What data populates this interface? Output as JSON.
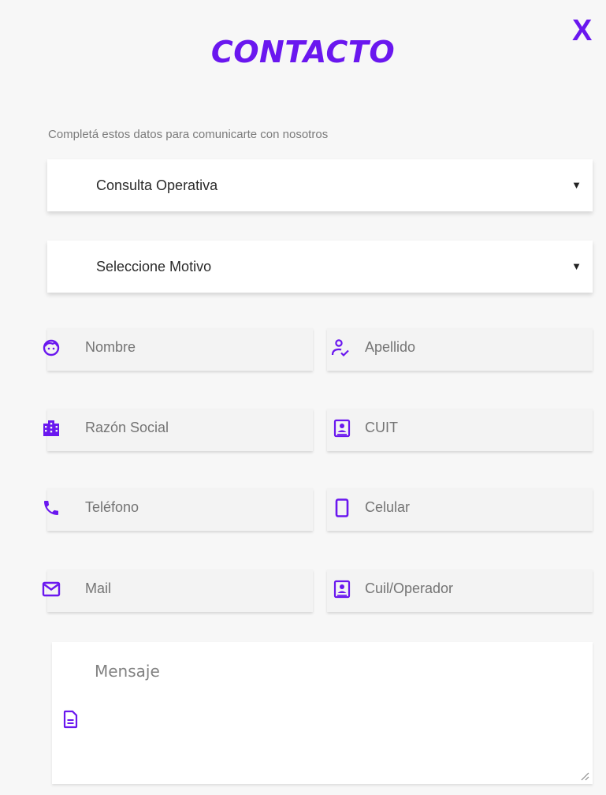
{
  "header": {
    "title": "CONTACTO",
    "close_label": "X",
    "subtitle": "Completá estos datos para comunicarte con nosotros"
  },
  "selects": {
    "consulta": {
      "value": "Consulta Operativa",
      "caret": "▼"
    },
    "motivo": {
      "value": "Seleccione Motivo",
      "caret": "▼"
    }
  },
  "fields": {
    "nombre": {
      "placeholder": "Nombre",
      "icon": "face-icon"
    },
    "apellido": {
      "placeholder": "Apellido",
      "icon": "person-check-icon"
    },
    "razon_social": {
      "placeholder": "Razón Social",
      "icon": "building-icon"
    },
    "cuit": {
      "placeholder": "CUIT",
      "icon": "contact-card-icon"
    },
    "telefono": {
      "placeholder": "Teléfono",
      "icon": "phone-icon"
    },
    "celular": {
      "placeholder": "Celular",
      "icon": "mobile-icon"
    },
    "mail": {
      "placeholder": "Mail",
      "icon": "mail-icon"
    },
    "cuil_operador": {
      "placeholder": "Cuil/Operador",
      "icon": "badge-icon"
    }
  },
  "message": {
    "placeholder": "Mensaje",
    "icon": "document-icon"
  },
  "colors": {
    "accent": "#6a17ef",
    "background": "#f7f7f7",
    "field": "#f3f3f3"
  }
}
